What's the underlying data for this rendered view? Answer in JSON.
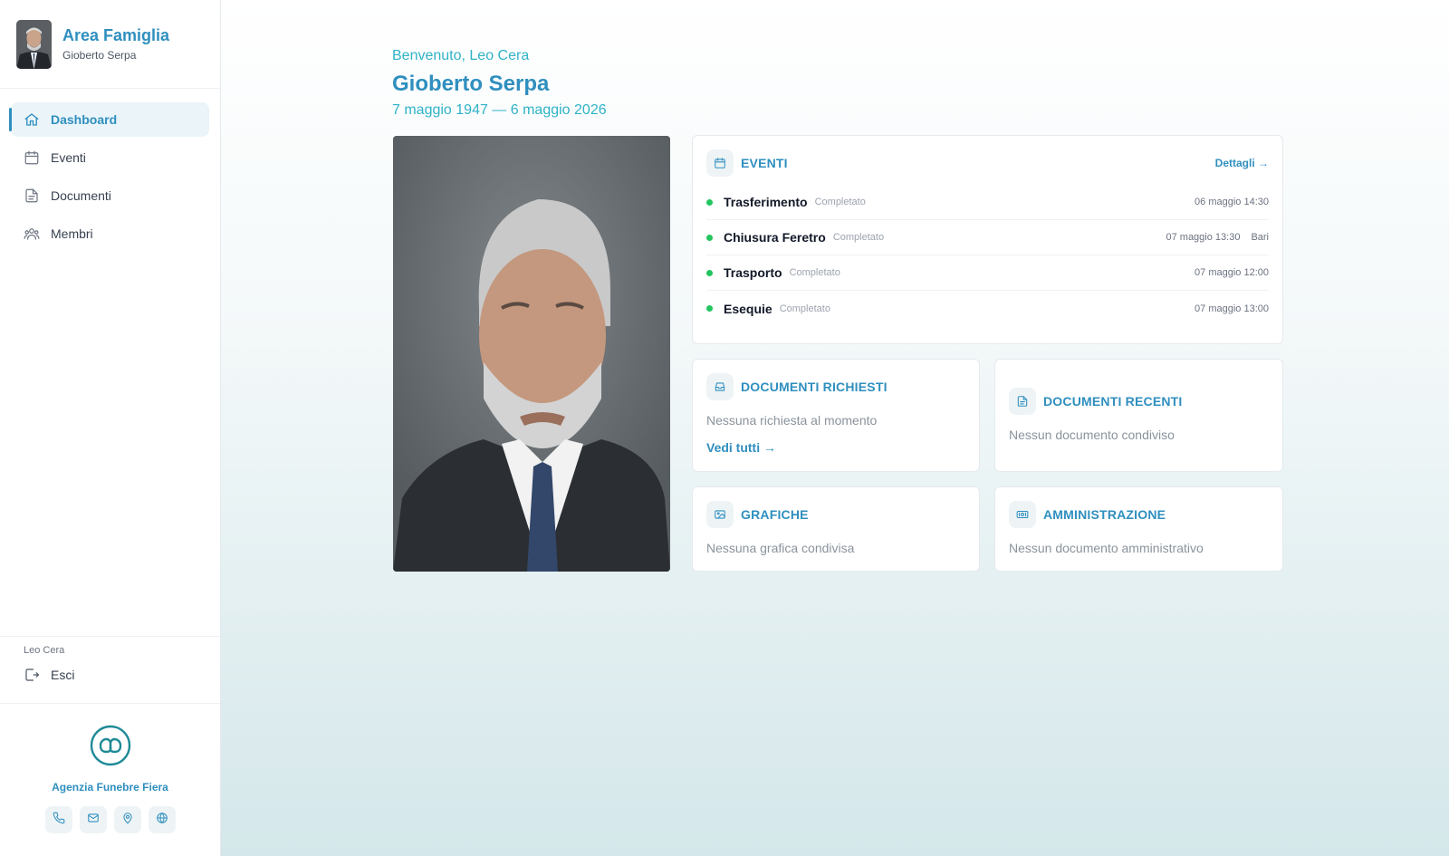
{
  "sidebar": {
    "brand_title": "Area Famiglia",
    "brand_sub": "Gioberto Serpa",
    "nav": [
      {
        "label": "Dashboard",
        "icon": "home-icon",
        "active": true
      },
      {
        "label": "Eventi",
        "icon": "calendar-icon",
        "active": false
      },
      {
        "label": "Documenti",
        "icon": "document-icon",
        "active": false
      },
      {
        "label": "Membri",
        "icon": "users-icon",
        "active": false
      }
    ],
    "user_name": "Leo Cera",
    "logout_label": "Esci",
    "agency_name": "Agenzia Funebre Fiera",
    "contacts": [
      "phone-icon",
      "mail-icon",
      "map-pin-icon",
      "globe-icon"
    ]
  },
  "main": {
    "welcome": "Benvenuto, Leo Cera",
    "name": "Gioberto Serpa",
    "dates": "7 maggio 1947 — 6 maggio 2026"
  },
  "events_card": {
    "title": "EVENTI",
    "details_label": "Dettagli →",
    "items": [
      {
        "title": "Trasferimento",
        "status": "Completato",
        "time": "06 maggio 14:30",
        "place": ""
      },
      {
        "title": "Chiusura Feretro",
        "status": "Completato",
        "time": "07 maggio 13:30",
        "place": "Bari"
      },
      {
        "title": "Trasporto",
        "status": "Completato",
        "time": "07 maggio 12:00",
        "place": ""
      },
      {
        "title": "Esequie",
        "status": "Completato",
        "time": "07 maggio 13:00",
        "place": ""
      }
    ]
  },
  "requested_docs": {
    "title": "DOCUMENTI RICHIESTI",
    "text": "Nessuna richiesta al momento",
    "link": "Vedi tutti →"
  },
  "recent_docs": {
    "title": "DOCUMENTI RECENTI",
    "text": "Nessun documento condiviso"
  },
  "graphics": {
    "title": "GRAFICHE",
    "text": "Nessuna grafica condivisa"
  },
  "admin": {
    "title": "AMMINISTRAZIONE",
    "text": "Nessun documento amministrativo"
  },
  "colors": {
    "accent": "#2f8fbf",
    "teal": "#2fb3c7",
    "status_dot": "#22c55e"
  }
}
